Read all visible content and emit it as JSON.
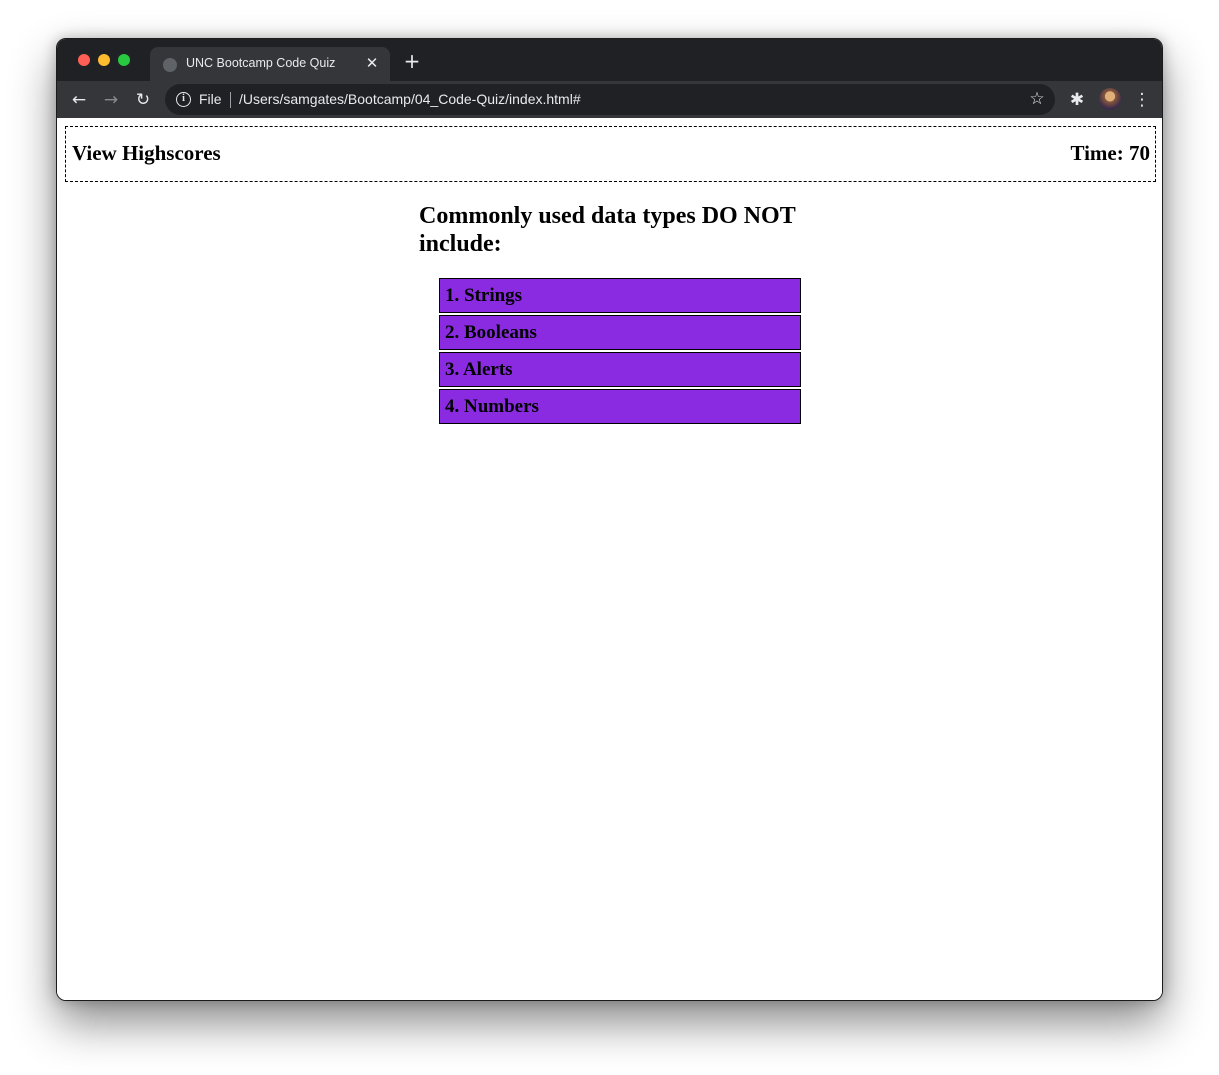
{
  "browser": {
    "tab_title": "UNC Bootcamp Code Quiz",
    "tab_close_glyph": "✕",
    "new_tab_glyph": "+",
    "back_glyph": "←",
    "forward_glyph": "→",
    "reload_glyph": "↻",
    "info_glyph": "i",
    "url_scheme_label": "File",
    "url": "/Users/samgates/Bootcamp/04_Code-Quiz/index.html#",
    "star_glyph": "☆",
    "extensions_glyph": "✱",
    "menu_glyph": "⋮"
  },
  "header": {
    "view_highscores": "View Highscores",
    "timer": "Time: 70"
  },
  "quiz": {
    "question": "Commonly used data types DO NOT include:",
    "answers": [
      "1. Strings",
      "2. Booleans",
      "3. Alerts",
      "4. Numbers"
    ],
    "answer_color": "#8a2be2"
  }
}
